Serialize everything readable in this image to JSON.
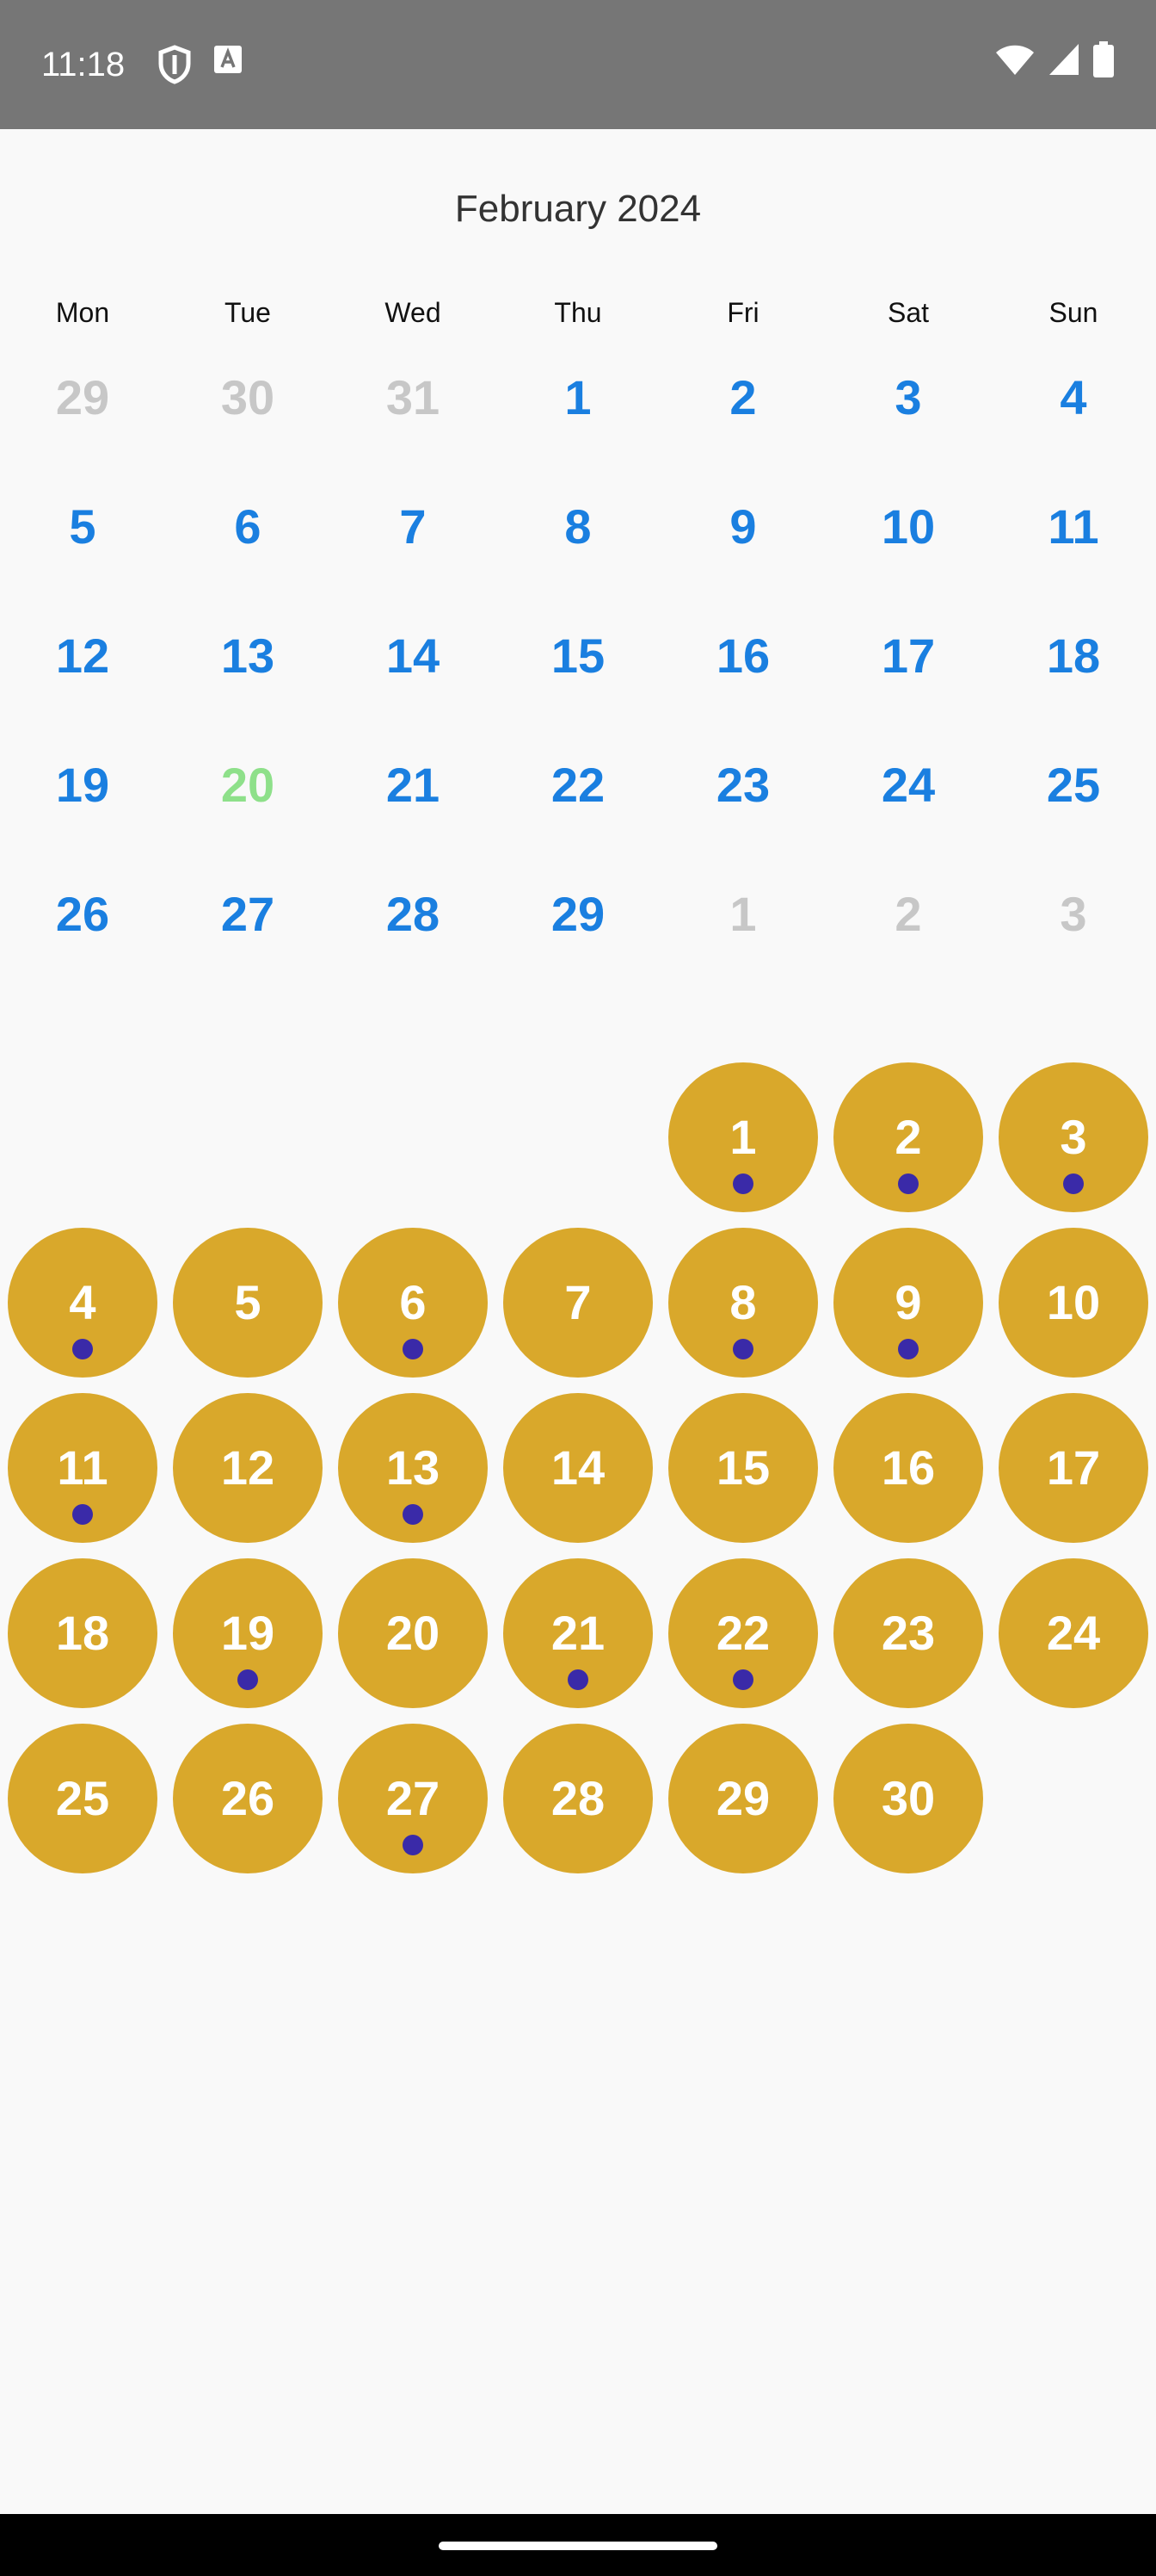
{
  "status_bar": {
    "time": "11:18",
    "icons_left": [
      "shield-icon",
      "translate-a-icon"
    ],
    "icons_right": [
      "wifi-icon",
      "signal-icon",
      "battery-icon"
    ]
  },
  "calendar": {
    "title": "February 2024",
    "weekdays": [
      "Mon",
      "Tue",
      "Wed",
      "Thu",
      "Fri",
      "Sat",
      "Sun"
    ],
    "days": [
      {
        "label": "29",
        "state": "muted"
      },
      {
        "label": "30",
        "state": "muted"
      },
      {
        "label": "31",
        "state": "muted"
      },
      {
        "label": "1",
        "state": "normal"
      },
      {
        "label": "2",
        "state": "normal"
      },
      {
        "label": "3",
        "state": "normal"
      },
      {
        "label": "4",
        "state": "normal"
      },
      {
        "label": "5",
        "state": "normal"
      },
      {
        "label": "6",
        "state": "normal"
      },
      {
        "label": "7",
        "state": "normal"
      },
      {
        "label": "8",
        "state": "normal"
      },
      {
        "label": "9",
        "state": "normal"
      },
      {
        "label": "10",
        "state": "normal"
      },
      {
        "label": "11",
        "state": "normal"
      },
      {
        "label": "12",
        "state": "normal"
      },
      {
        "label": "13",
        "state": "normal"
      },
      {
        "label": "14",
        "state": "normal"
      },
      {
        "label": "15",
        "state": "normal"
      },
      {
        "label": "16",
        "state": "normal"
      },
      {
        "label": "17",
        "state": "normal"
      },
      {
        "label": "18",
        "state": "normal"
      },
      {
        "label": "19",
        "state": "normal"
      },
      {
        "label": "20",
        "state": "today"
      },
      {
        "label": "21",
        "state": "normal"
      },
      {
        "label": "22",
        "state": "normal"
      },
      {
        "label": "23",
        "state": "normal"
      },
      {
        "label": "24",
        "state": "normal"
      },
      {
        "label": "25",
        "state": "normal"
      },
      {
        "label": "26",
        "state": "normal"
      },
      {
        "label": "27",
        "state": "normal"
      },
      {
        "label": "28",
        "state": "normal"
      },
      {
        "label": "29",
        "state": "normal"
      },
      {
        "label": "1",
        "state": "muted"
      },
      {
        "label": "2",
        "state": "muted"
      },
      {
        "label": "3",
        "state": "muted"
      }
    ]
  },
  "circle_calendar": {
    "leading_empty": 4,
    "days": [
      {
        "label": "1",
        "event": true
      },
      {
        "label": "2",
        "event": true
      },
      {
        "label": "3",
        "event": true
      },
      {
        "label": "4",
        "event": true
      },
      {
        "label": "5",
        "event": false
      },
      {
        "label": "6",
        "event": true
      },
      {
        "label": "7",
        "event": false
      },
      {
        "label": "8",
        "event": true
      },
      {
        "label": "9",
        "event": true
      },
      {
        "label": "10",
        "event": false
      },
      {
        "label": "11",
        "event": true
      },
      {
        "label": "12",
        "event": false
      },
      {
        "label": "13",
        "event": true
      },
      {
        "label": "14",
        "event": false
      },
      {
        "label": "15",
        "event": false
      },
      {
        "label": "16",
        "event": false
      },
      {
        "label": "17",
        "event": false
      },
      {
        "label": "18",
        "event": false
      },
      {
        "label": "19",
        "event": true
      },
      {
        "label": "20",
        "event": false
      },
      {
        "label": "21",
        "event": true
      },
      {
        "label": "22",
        "event": true
      },
      {
        "label": "23",
        "event": false
      },
      {
        "label": "24",
        "event": false
      },
      {
        "label": "25",
        "event": false
      },
      {
        "label": "26",
        "event": false
      },
      {
        "label": "27",
        "event": true
      },
      {
        "label": "28",
        "event": false
      },
      {
        "label": "29",
        "event": false
      },
      {
        "label": "30",
        "event": false
      }
    ]
  },
  "colors": {
    "day_normal": "#1a7fe0",
    "day_muted": "#c7c7c7",
    "day_today": "#8ee08a",
    "circle_fill": "#d9a82b",
    "event_dot": "#3a2aa8",
    "status_bar": "#767676"
  }
}
